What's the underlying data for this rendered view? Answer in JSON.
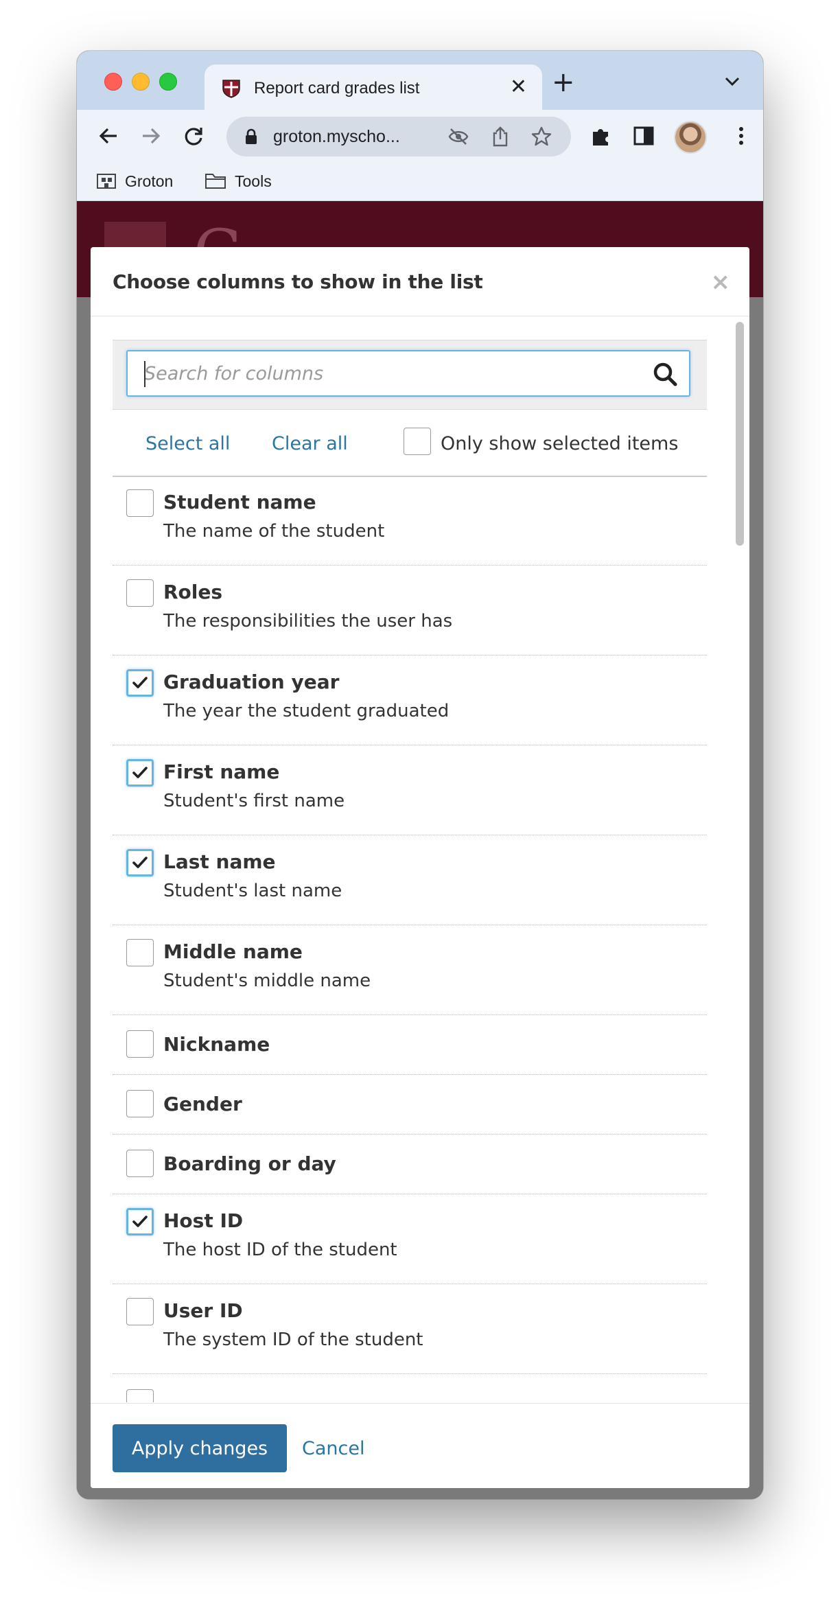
{
  "browser": {
    "tab_title": "Report card grades list",
    "url": "groton.myscho...",
    "bookmarks": [
      "Groton",
      "Tools"
    ]
  },
  "dialog": {
    "title": "Choose columns to show in the list",
    "search_placeholder": "Search for columns",
    "select_all": "Select all",
    "clear_all": "Clear all",
    "only_selected_label": "Only show selected items",
    "only_selected_checked": false,
    "columns": [
      {
        "title": "Student name",
        "description": "The name of the student",
        "checked": false
      },
      {
        "title": "Roles",
        "description": "The responsibilities the user has",
        "checked": false
      },
      {
        "title": "Graduation year",
        "description": "The year the student graduated",
        "checked": true
      },
      {
        "title": "First name",
        "description": "Student's first name",
        "checked": true
      },
      {
        "title": "Last name",
        "description": "Student's last name",
        "checked": true
      },
      {
        "title": "Middle name",
        "description": "Student's middle name",
        "checked": false
      },
      {
        "title": "Nickname",
        "description": "",
        "checked": false
      },
      {
        "title": "Gender",
        "description": "",
        "checked": false
      },
      {
        "title": "Boarding or day",
        "description": "",
        "checked": false
      },
      {
        "title": "Host ID",
        "description": "The host ID of the student",
        "checked": true
      },
      {
        "title": "User ID",
        "description": "The system ID of the student",
        "checked": false
      }
    ],
    "apply_label": "Apply changes",
    "cancel_label": "Cancel"
  },
  "colors": {
    "accent": "#2f6fa0",
    "link": "#2a75a3",
    "focus": "#66b4e0",
    "brand": "#500d1e"
  }
}
